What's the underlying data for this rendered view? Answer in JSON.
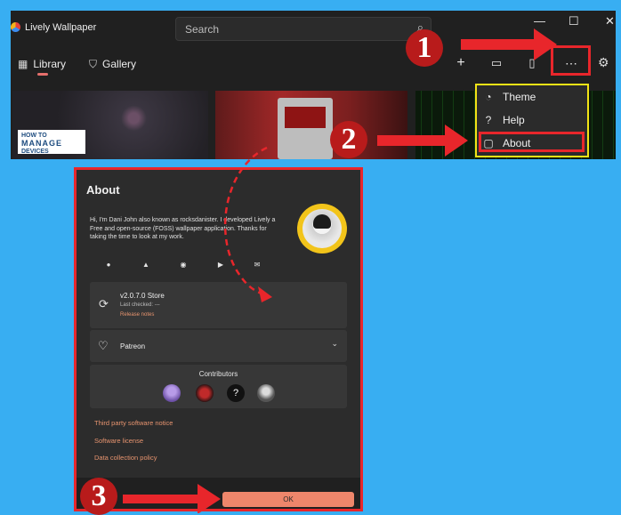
{
  "app": {
    "title": "Lively Wallpaper",
    "search_placeholder": "Search",
    "tabs": [
      {
        "label": "Library",
        "icon": "grid-icon"
      },
      {
        "label": "Gallery",
        "icon": "bag-icon"
      }
    ]
  },
  "logo": {
    "line1": "HOW TO",
    "line2": "MANAGE",
    "line3": "DEVICES"
  },
  "menu": {
    "items": [
      {
        "label": "Theme",
        "icon": "palette-icon"
      },
      {
        "label": "Help",
        "icon": "question-icon"
      },
      {
        "label": "About",
        "icon": "chat-icon"
      }
    ]
  },
  "callouts": [
    "1",
    "2",
    "3"
  ],
  "about": {
    "title": "About",
    "intro": "Hi, I'm Dani John also known as rocksdanister. I developed Lively a Free and open-source (FOSS) wallpaper application. Thanks for taking the time to look at my work.",
    "version": "v2.0.7.0 Store",
    "last_checked": "Last checked: ---",
    "release_notes": "Release notes",
    "patreon": "Patreon",
    "contributors_label": "Contributors",
    "links": [
      "Third party software notice",
      "Software license",
      "Data collection policy"
    ],
    "ok_label": "OK"
  },
  "colors": {
    "accent": "#ee866b",
    "highlight_red": "#e8262b",
    "highlight_yellow": "#f2e316",
    "background": "#38aef2"
  }
}
